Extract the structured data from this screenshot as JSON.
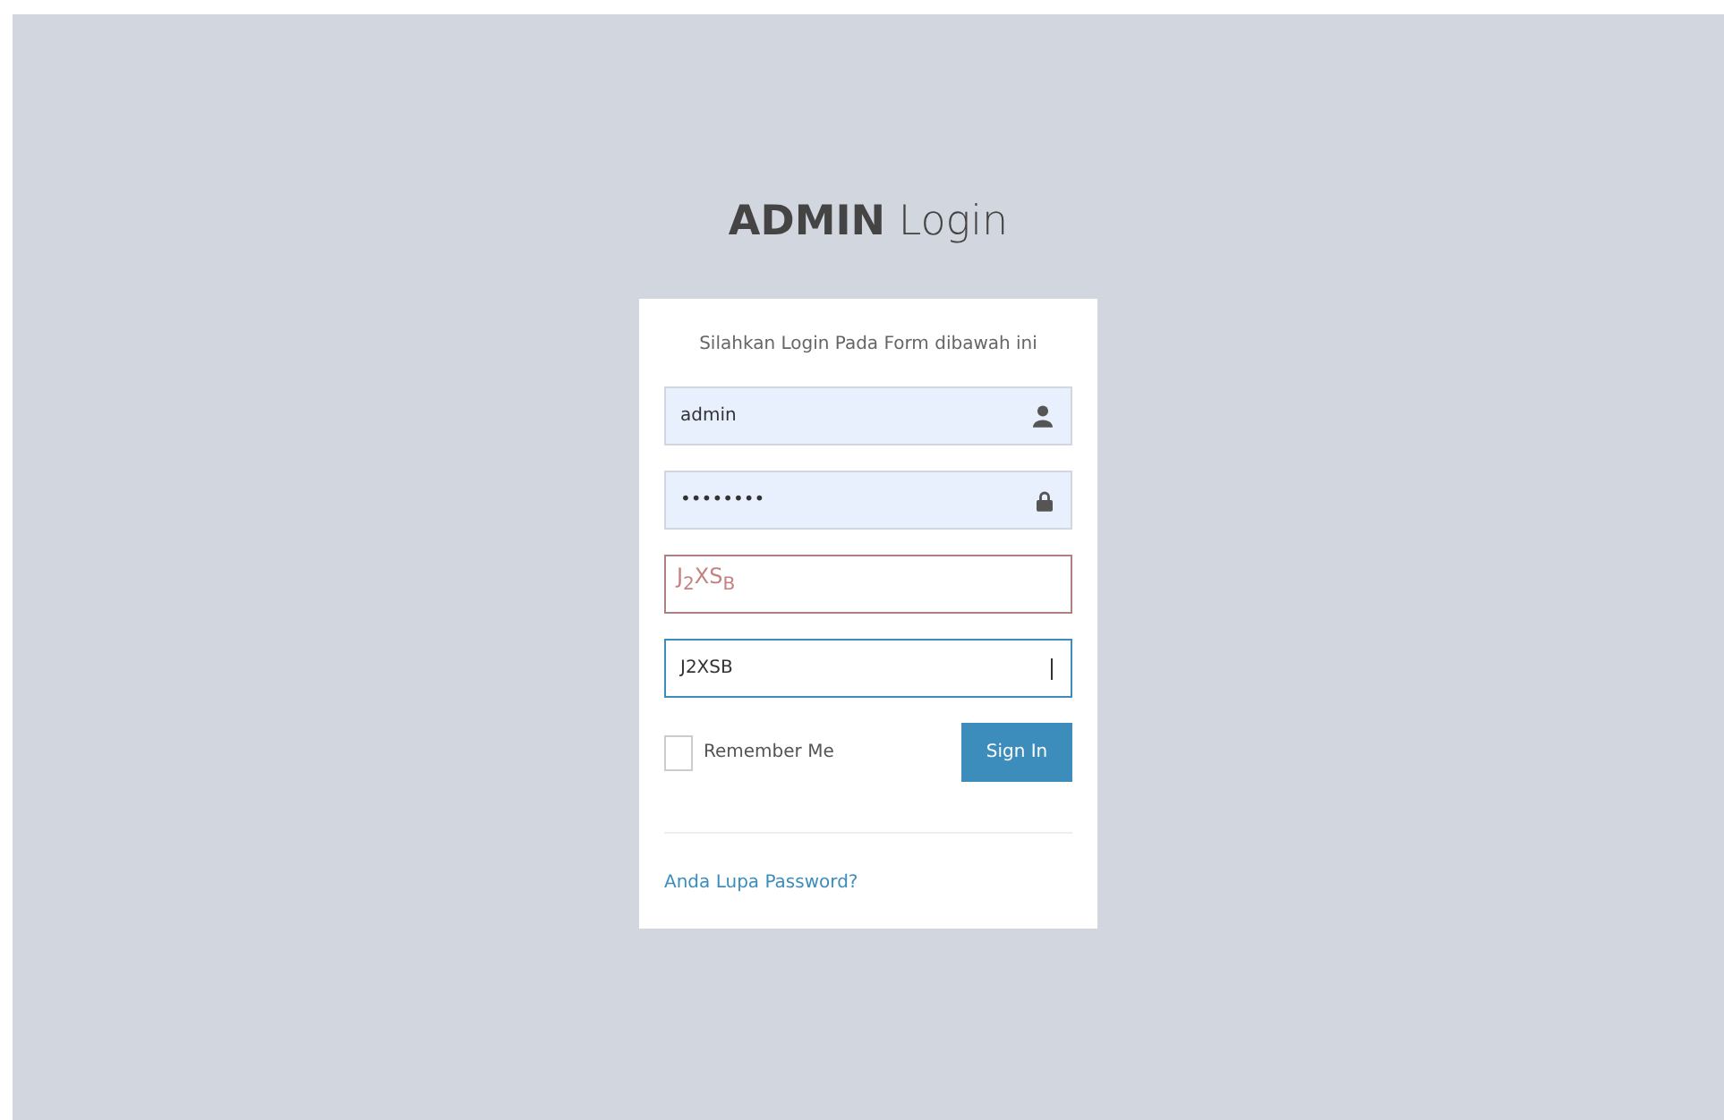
{
  "title": {
    "bold": "ADMIN",
    "light": "Login"
  },
  "card": {
    "message": "Silahkan Login Pada Form dibawah ini",
    "username": {
      "value": "admin"
    },
    "password": {
      "value": "••••••••"
    },
    "captcha": {
      "text": "J$_{2}$XS$_{B}$"
    },
    "captcha_input": {
      "value": "J2XSB",
      "focused": true
    },
    "remember_me": {
      "label": "Remember Me",
      "checked": false
    },
    "sign_in": "Sign In",
    "forgot_link": "Anda Lupa Password?"
  }
}
